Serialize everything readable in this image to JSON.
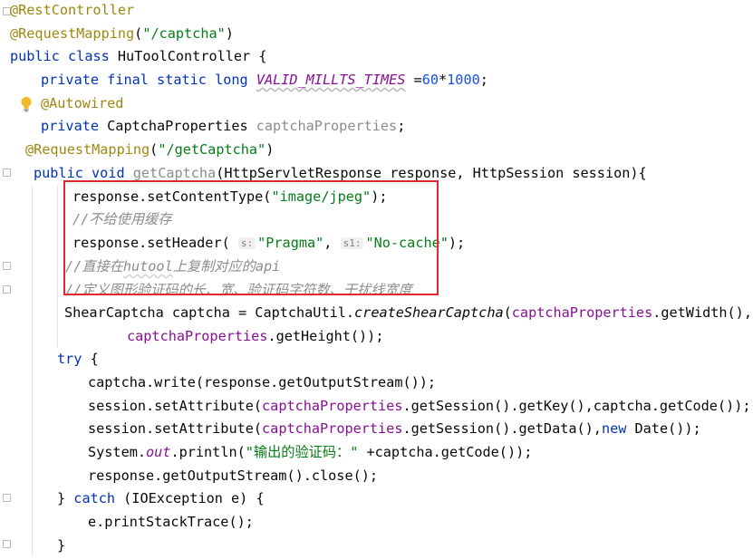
{
  "editor": {
    "lines": [
      [
        "@RestController"
      ],
      [
        "@RequestMapping",
        "(",
        "\"/captcha\"",
        ")"
      ],
      [
        "public",
        " ",
        "class",
        " HuToolController {"
      ],
      [
        "private",
        " ",
        "final",
        " ",
        "static",
        " ",
        "long",
        " ",
        "VALID_MILLTS_TIMES",
        " =",
        "60",
        "*",
        "1000",
        ";"
      ],
      [
        "@Autowired"
      ],
      [
        "private",
        " CaptchaProperties ",
        "captchaProperties",
        ";"
      ],
      [
        "@RequestMapping",
        "(",
        "\"/getCaptcha\"",
        ")"
      ],
      [
        "public",
        " ",
        "void",
        " ",
        "getCaptcha",
        "(HttpServletResponse response, HttpSession session){"
      ],
      [
        "response.setContentType(",
        "\"image/jpeg\"",
        ");"
      ],
      [
        "//不给使用缓存"
      ],
      [
        "response.setHeader( ",
        "s:",
        "\"Pragma\"",
        ", ",
        "s1:",
        "\"No-cache\"",
        ");"
      ],
      [
        "//直接在",
        "hutool",
        "上复制对应的",
        "api"
      ],
      [
        "//定义图形验证码的长、宽、验证码字符数、干扰线宽度"
      ],
      [
        "ShearCaptcha captcha = CaptchaUtil.",
        "createShearCaptcha",
        "(",
        "captchaProperties",
        ".getWidth(),"
      ],
      [
        "captchaProperties",
        ".getHeight());"
      ],
      [
        "try",
        " {"
      ],
      [
        "captcha.write(response.getOutputStream());"
      ],
      [
        "session.setAttribute(",
        "captchaProperties",
        ".getSession().getKey(),captcha.getCode());"
      ],
      [
        "session.setAttribute(",
        "captchaProperties",
        ".getSession().getData(),",
        "new",
        " Date());"
      ],
      [
        "System.",
        "out",
        ".println(",
        "\"输出的验证码：\"",
        " +captcha.getCode());"
      ],
      [
        "response.getOutputStream().close();"
      ],
      [
        "} ",
        "catch",
        " (IOException e) {"
      ],
      [
        "e.printStackTrace();"
      ],
      [
        "}"
      ]
    ]
  },
  "icons": {
    "bulb": "lightbulb-icon",
    "fold": "fold-marker-icon"
  },
  "colors": {
    "annotation": "#9e880d",
    "string": "#067d17",
    "keyword": "#0033b3",
    "field": "#871094",
    "number": "#1750eb",
    "comment": "#8c8c8c",
    "highlight_box": "#e0282e"
  }
}
